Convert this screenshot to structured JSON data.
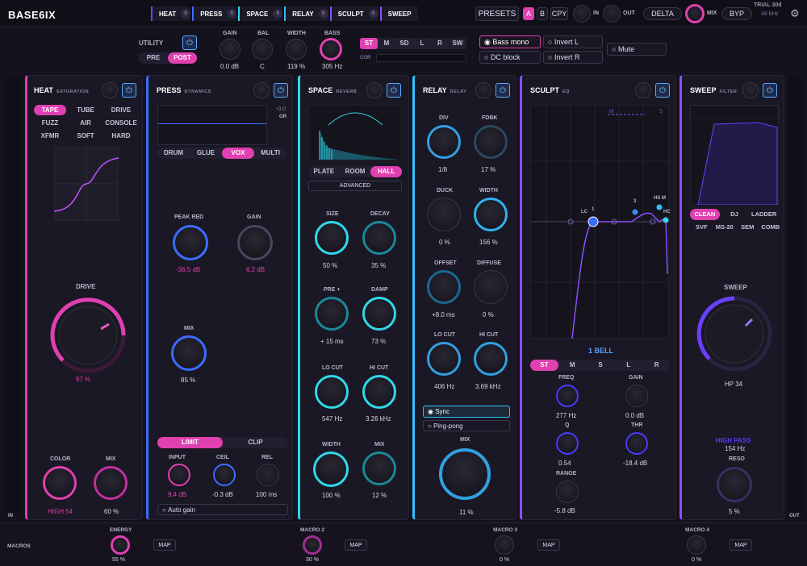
{
  "app": {
    "title": "BASE6IX",
    "trial": "TRIAL 30d",
    "sample_rate": "48 kHz"
  },
  "chain": [
    {
      "label": "HEAT",
      "s": "S"
    },
    {
      "label": "PRESS",
      "s": "S"
    },
    {
      "label": "SPACE",
      "s": "S"
    },
    {
      "label": "RELAY",
      "s": "S"
    },
    {
      "label": "SCULPT",
      "s": "S"
    },
    {
      "label": "SWEEP",
      "s": "S"
    }
  ],
  "top": {
    "presets": "PRESETS",
    "a": "A",
    "b": "B",
    "cpy": "CPY",
    "in": "IN",
    "out": "OUT",
    "delta": "DELTA",
    "mix": "MIX",
    "byp": "BYP"
  },
  "utility": {
    "title": "UTILITY",
    "pre": "PRE",
    "post": "POST",
    "gain_l": "GAIN",
    "gain_v": "0.0 dB",
    "bal_l": "BAL",
    "bal_v": "C",
    "width_l": "WIDTH",
    "width_v": "119 %",
    "bass_l": "BASS",
    "bass_v": "305 Hz",
    "modes": [
      "ST",
      "M",
      "SD",
      "L",
      "R",
      "SW"
    ],
    "cor": "COR",
    "bass_mono": "Bass mono",
    "dc_block": "DC block",
    "invert_l": "Invert L",
    "invert_r": "Invert R",
    "mute": "Mute"
  },
  "heat": {
    "title": "HEAT",
    "sub": "SATURATION",
    "modes": [
      "TAPE",
      "TUBE",
      "DRIVE",
      "FUZZ",
      "AIR",
      "CONSOLE",
      "XFMR",
      "SOFT",
      "HARD"
    ],
    "drive_l": "DRIVE",
    "drive_v": "97 %",
    "color_l": "COLOR",
    "color_v": "HIGH 54",
    "mix_l": "MIX",
    "mix_v": "60 %"
  },
  "press": {
    "title": "PRESS",
    "sub": "DYNAMICS",
    "gr_v": "-0.0",
    "gr": "GR",
    "modes": [
      "DRUM",
      "GLUE",
      "VOX",
      "MULTI"
    ],
    "peak_l": "PEAK RED",
    "peak_v": "-36.5 dB",
    "gain_l": "GAIN",
    "gain_v": "6.2 dB",
    "mix_l": "MIX",
    "mix_v": "85 %",
    "limit": "LIMIT",
    "clip": "CLIP",
    "input_l": "INPUT",
    "input_v": "9.4 dB",
    "ceil_l": "CEIL",
    "ceil_v": "-0.3 dB",
    "rel_l": "REL",
    "rel_v": "100 ms",
    "auto_gain": "Auto gain"
  },
  "space": {
    "title": "SPACE",
    "sub": "REVERB",
    "modes": [
      "PLATE",
      "ROOM",
      "HALL"
    ],
    "advanced": "ADVANCED",
    "size_l": "SIZE",
    "size_v": "50 %",
    "decay_l": "DECAY",
    "decay_v": "35 %",
    "pre_l": "PRE +",
    "pre_v": "+ 15 ms",
    "damp_l": "DAMP",
    "damp_v": "73 %",
    "locut_l": "LO CUT",
    "locut_v": "547 Hz",
    "hicut_l": "HI CUT",
    "hicut_v": "3.26 kHz",
    "width_l": "WIDTH",
    "width_v": "100 %",
    "mix_l": "MIX",
    "mix_v": "12 %"
  },
  "relay": {
    "title": "RELAY",
    "sub": "DELAY",
    "div_l": "DIV",
    "div_v": "1/8",
    "fdbk_l": "FDBK",
    "fdbk_v": "17 %",
    "duck_l": "DUCK",
    "duck_v": "0 %",
    "width_l": "WIDTH",
    "width_v": "156 %",
    "offset_l": "OFFSET",
    "offset_v": "+8.0 ms",
    "diffuse_l": "DIFFUSE",
    "diffuse_v": "0 %",
    "locut_l": "LO CUT",
    "locut_v": "406 Hz",
    "hicut_l": "HI CUT",
    "hicut_v": "3.69 kHz",
    "sync": "Sync",
    "pingpong": "Ping-pong",
    "mix_l": "MIX",
    "mix_v": "11 %"
  },
  "sculpt": {
    "title": "SCULPT",
    "sub": "EQ",
    "band": "1  BELL",
    "mlegend": "M",
    "slegend": "S",
    "nodes": [
      "LC",
      "1",
      "3",
      "HS M",
      "HC"
    ],
    "modes": [
      "ST",
      "M",
      "S",
      "L",
      "R"
    ],
    "freq_l": "FREQ",
    "freq_v": "277 Hz",
    "gain_l": "GAIN",
    "gain_v": "0.0 dB",
    "q_l": "Q",
    "q_v": "0.54",
    "thr_l": "THR",
    "thr_v": "-18.4 dB",
    "range_l": "RANGE",
    "range_v": "-5.8 dB"
  },
  "sweep": {
    "title": "SWEEP",
    "sub": "FILTER",
    "modes": [
      "CLEAN",
      "DJ",
      "LADDER"
    ],
    "types": [
      "SVF",
      "MS-20",
      "SEM",
      "COMB"
    ],
    "sweep_l": "SWEEP",
    "sweep_v": "HP 34",
    "hp_l": "HIGH PASS",
    "hp_v": "154 Hz",
    "reso_l": "RESO",
    "reso_v": "5 %"
  },
  "meters": {
    "in": "IN",
    "out": "OUT"
  },
  "macros": {
    "title": "MACROS",
    "items": [
      {
        "label": "ENERGY",
        "value": "55 %",
        "map": "MAP"
      },
      {
        "label": "MACRO 2",
        "value": "30 %",
        "map": "MAP"
      },
      {
        "label": "MACRO 3",
        "value": "0 %",
        "map": "MAP"
      },
      {
        "label": "MACRO 4",
        "value": "0 %",
        "map": "MAP"
      }
    ]
  },
  "colors": {
    "pink": "#e040b0",
    "cyan": "#30d8e8",
    "blue": "#3a6cff",
    "purple": "#8a50ff"
  }
}
